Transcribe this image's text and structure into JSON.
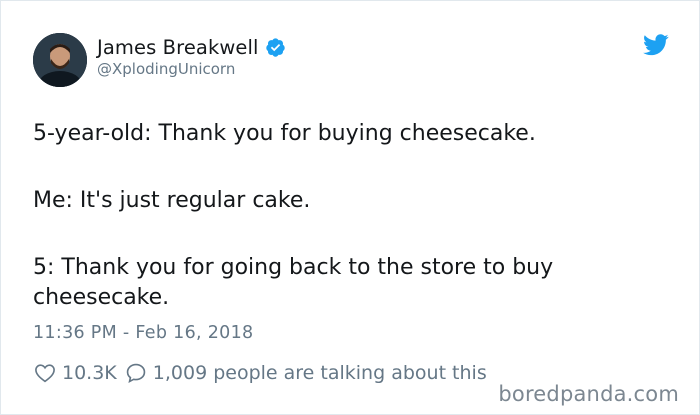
{
  "author": {
    "display_name": "James Breakwell",
    "handle": "@XplodingUnicorn",
    "verified": true,
    "avatar_icon": "avatar-photo"
  },
  "platform_icon": "twitter-bird-icon",
  "tweet": {
    "paragraphs": [
      "5-year-old: Thank you for buying cheesecake.",
      "Me: It's just regular cake.",
      "5: Thank you for going back to the store to buy cheesecake."
    ],
    "timestamp": "11:36 PM - Feb 16, 2018"
  },
  "engagement": {
    "likes": "10.3K",
    "replies_text": "1,009 people are talking about this"
  },
  "watermark": "boredpanda.com",
  "colors": {
    "accent": "#1da1f2",
    "text": "#14171a",
    "muted": "#657786",
    "border": "#e1e8ed"
  }
}
